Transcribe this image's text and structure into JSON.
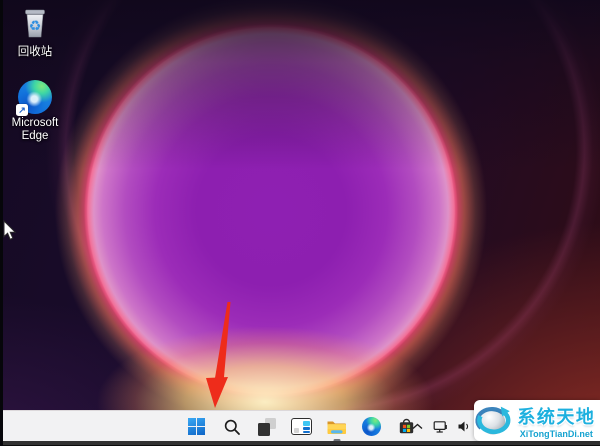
{
  "desktop_icons": [
    {
      "id": "recycle-bin",
      "label": "回收站"
    },
    {
      "id": "microsoft-edge",
      "label_line1": "Microsoft",
      "label_line2": "Edge"
    }
  ],
  "taskbar": {
    "buttons": [
      {
        "id": "start",
        "icon": "windows-start-icon"
      },
      {
        "id": "search",
        "icon": "search-icon"
      },
      {
        "id": "task-view",
        "icon": "task-view-icon"
      },
      {
        "id": "widgets",
        "icon": "widgets-icon"
      },
      {
        "id": "file-explorer",
        "icon": "file-explorer-icon",
        "running_indicator": true
      },
      {
        "id": "edge",
        "icon": "edge-icon"
      },
      {
        "id": "store",
        "icon": "microsoft-store-icon"
      }
    ],
    "tray_icons": [
      {
        "id": "hidden-icons",
        "icon": "chevron-up-icon"
      },
      {
        "id": "network",
        "icon": "network-icon"
      },
      {
        "id": "volume",
        "icon": "speaker-icon"
      }
    ]
  },
  "watermark": {
    "site_name": "系统天地",
    "site_url": "XiTongTianDi.net",
    "accent_color": "#1cb0df"
  },
  "annotation": {
    "type": "red-arrow",
    "points_to": "start-button",
    "color": "#ee2c1b"
  },
  "colors": {
    "taskbar_bg": "#f2f2f3",
    "bottom_strip": "#323232",
    "wallpaper_center": "#8d1fb0",
    "wallpaper_rim": "#f84c78"
  }
}
